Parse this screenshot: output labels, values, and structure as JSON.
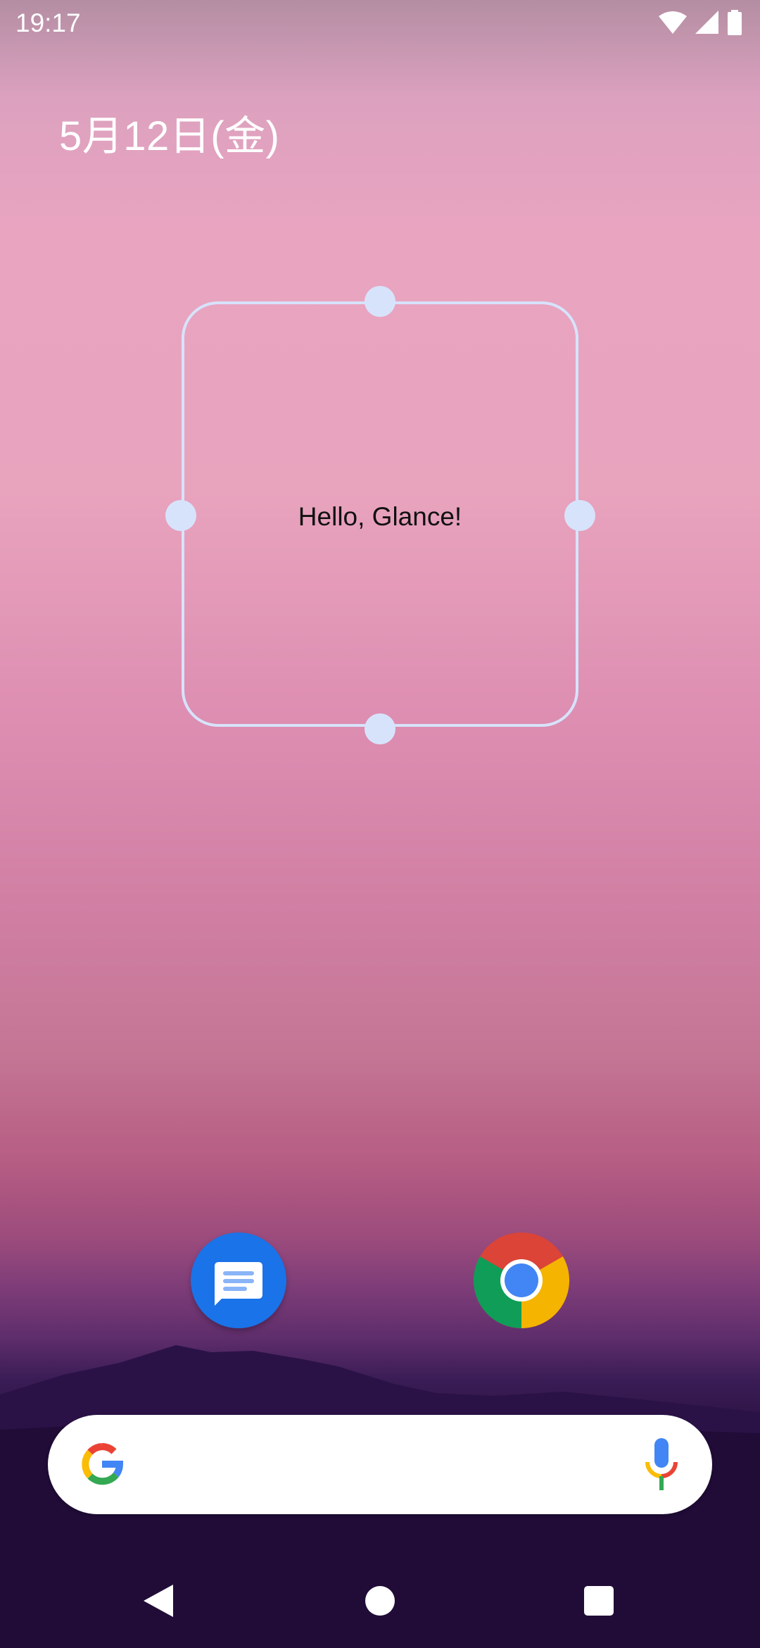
{
  "status_bar": {
    "time": "19:17",
    "icons": [
      "wifi-icon",
      "cell-signal-icon",
      "battery-icon"
    ]
  },
  "home": {
    "date": "5月12日(金)"
  },
  "widget": {
    "text": "Hello, Glance!",
    "frame_color": "#d7e3fb"
  },
  "dock": {
    "apps": [
      {
        "name": "messages-icon",
        "color": "#1a73e8"
      },
      {
        "name": "chrome-icon",
        "color": "#4285f4"
      }
    ]
  },
  "search": {
    "icons": [
      "google-g-icon",
      "mic-icon"
    ]
  },
  "nav": {
    "buttons": [
      "back-icon",
      "home-icon",
      "recents-icon"
    ]
  }
}
